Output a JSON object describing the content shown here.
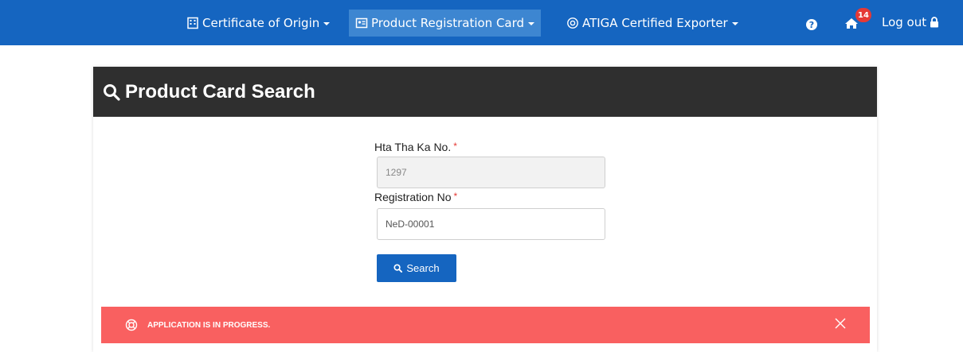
{
  "nav": {
    "items": [
      {
        "label": "Certificate of Origin",
        "icon": "building-icon"
      },
      {
        "label": "Product Registration Card",
        "icon": "id-card-icon"
      },
      {
        "label": "ATIGA Certified Exporter",
        "icon": "at-sign-icon"
      }
    ],
    "notification_count": "14",
    "logout_label": "Log out"
  },
  "card": {
    "title": "Product Card Search",
    "hta_label": "Hta Tha Ka No.",
    "hta_value": "1297",
    "reg_label": "Registration No",
    "reg_value": "NeD-00001",
    "required_mark": "*",
    "search_label": "Search"
  },
  "alert": {
    "text": "APPLICATION IS IN PROGRESS."
  },
  "colors": {
    "navbar": "#1565c0",
    "active_nav": "#3d86d1",
    "header": "#2f2f2f",
    "alert": "#f96060"
  }
}
